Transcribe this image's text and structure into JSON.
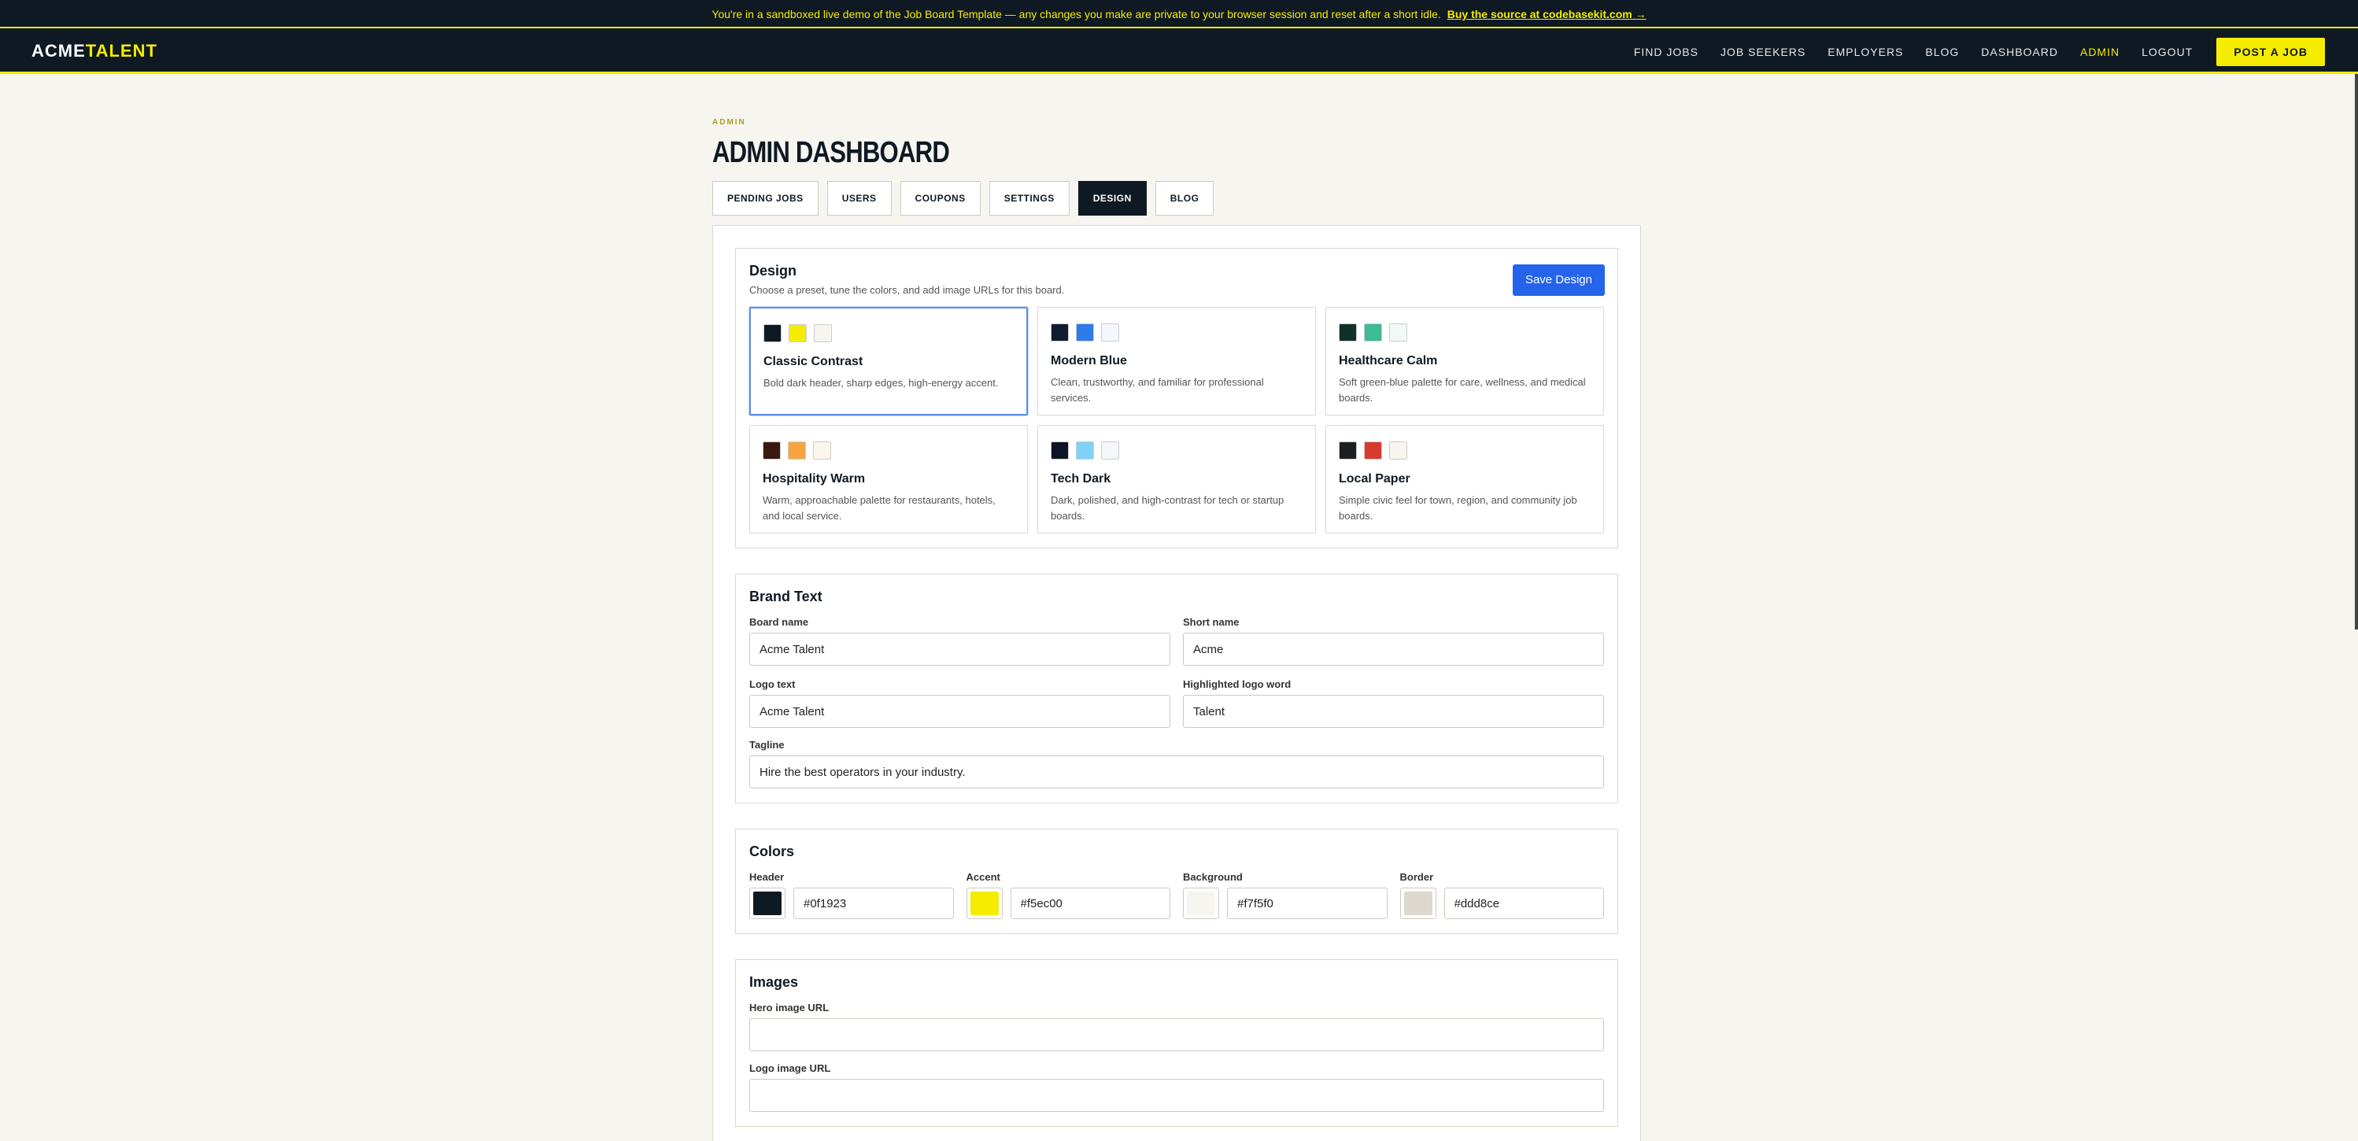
{
  "banner": {
    "text": "You're in a sandboxed live demo of the Job Board Template — any changes you make are private to your browser session and reset after a short idle.",
    "link": "Buy the source at codebasekit.com →"
  },
  "header": {
    "logo_main": "ACME",
    "logo_accent": "TALENT",
    "nav": [
      "FIND JOBS",
      "JOB SEEKERS",
      "EMPLOYERS",
      "BLOG",
      "DASHBOARD",
      "ADMIN",
      "LOGOUT"
    ],
    "post_button": "POST A JOB"
  },
  "page": {
    "eyebrow": "ADMIN",
    "title": "ADMIN DASHBOARD",
    "tabs": [
      "PENDING JOBS",
      "USERS",
      "COUPONS",
      "SETTINGS",
      "DESIGN",
      "BLOG"
    ],
    "active_tab": "DESIGN"
  },
  "design": {
    "title": "Design",
    "subtitle": "Choose a preset, tune the colors, and add image URLs for this board.",
    "save_label": "Save Design",
    "presets": [
      {
        "name": "Classic Contrast",
        "desc": "Bold dark header, sharp edges, high-energy accent.",
        "colors": [
          "#0f1923",
          "#f5ec00",
          "#f7f5f0"
        ]
      },
      {
        "name": "Modern Blue",
        "desc": "Clean, trustworthy, and familiar for professional services.",
        "colors": [
          "#0f1d33",
          "#2f7bea",
          "#f4f7fb"
        ]
      },
      {
        "name": "Healthcare Calm",
        "desc": "Soft green-blue palette for care, wellness, and medical boards.",
        "colors": [
          "#10302a",
          "#3dbb94",
          "#f1f8f5"
        ]
      },
      {
        "name": "Hospitality Warm",
        "desc": "Warm, approachable palette for restaurants, hotels, and local service.",
        "colors": [
          "#3a1a10",
          "#f5a540",
          "#fbf5ec"
        ]
      },
      {
        "name": "Tech Dark",
        "desc": "Dark, polished, and high-contrast for tech or startup boards.",
        "colors": [
          "#0c1326",
          "#7fd2f7",
          "#f4f6fa"
        ]
      },
      {
        "name": "Local Paper",
        "desc": "Simple civic feel for town, region, and community job boards.",
        "colors": [
          "#1d2022",
          "#d93a2e",
          "#f8f4ee"
        ]
      }
    ]
  },
  "brand": {
    "title": "Brand Text",
    "board_name_label": "Board name",
    "board_name": "Acme Talent",
    "short_name_label": "Short name",
    "short_name": "Acme",
    "logo_text_label": "Logo text",
    "logo_text": "Acme Talent",
    "highlight_label": "Highlighted logo word",
    "highlight": "Talent",
    "tagline_label": "Tagline",
    "tagline": "Hire the best operators in your industry."
  },
  "colors": {
    "title": "Colors",
    "items": [
      {
        "label": "Header",
        "value": "#0f1923"
      },
      {
        "label": "Accent",
        "value": "#f5ec00"
      },
      {
        "label": "Background",
        "value": "#f7f5f0"
      },
      {
        "label": "Border",
        "value": "#ddd8ce"
      }
    ]
  },
  "images": {
    "title": "Images",
    "hero_label": "Hero image URL",
    "hero_value": "",
    "logo_label": "Logo image URL",
    "logo_value": ""
  }
}
